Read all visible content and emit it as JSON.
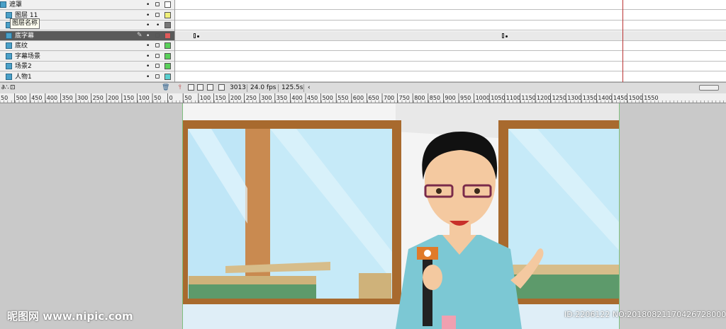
{
  "layers": [
    {
      "name": "遮罩",
      "color": "#ffffff",
      "indent": 0,
      "selected": false
    },
    {
      "name": "图层 11",
      "color": "#f0f07a",
      "indent": 1,
      "selected": false
    },
    {
      "name": "",
      "color": "#777777",
      "indent": 1,
      "selected": false
    },
    {
      "name": "底字幕",
      "color": "#e05a5a",
      "indent": 1,
      "selected": true
    },
    {
      "name": "底纹",
      "color": "#5ad05a",
      "indent": 1,
      "selected": false
    },
    {
      "name": "字幕场景",
      "color": "#5ad05a",
      "indent": 1,
      "selected": false
    },
    {
      "name": "场景2",
      "color": "#5ad05a",
      "indent": 1,
      "selected": false
    },
    {
      "name": "人物1",
      "color": "#5ad0d0",
      "indent": 1,
      "selected": false
    }
  ],
  "tooltip": "图层名称",
  "timeline_bar": {
    "frame": "3013",
    "fps": "24.0 fps",
    "time": "125.5s"
  },
  "ruler_labels": [
    "50",
    "500",
    "450",
    "400",
    "350",
    "300",
    "250",
    "200",
    "150",
    "100",
    "50",
    "0",
    "50",
    "100",
    "150",
    "200",
    "250",
    "300",
    "350",
    "400",
    "450",
    "500",
    "550",
    "600",
    "650",
    "700",
    "750",
    "800",
    "850",
    "900",
    "950",
    "1000",
    "1050",
    "1100",
    "1150",
    "1200",
    "1250",
    "1300",
    "1350",
    "1400",
    "1450",
    "1500",
    "1550"
  ],
  "watermark": {
    "left": "昵图网 www.nipic.com",
    "right": "ID:2206122 NO:20180821170426728000"
  },
  "colors": {
    "sky": "#bfe6f7",
    "frame_wood": "#a86a2e",
    "shirt": "#7cc8d4",
    "skin": "#f4c9a0"
  }
}
